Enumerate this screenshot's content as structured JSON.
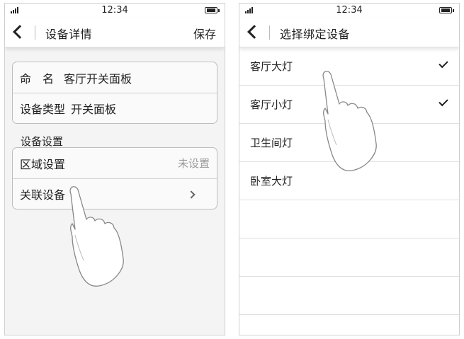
{
  "left_screen": {
    "status": {
      "time": "12:34"
    },
    "header": {
      "title": "设备详情",
      "action": "保存"
    },
    "info_card": {
      "rows": [
        {
          "label": "命　名",
          "value": "客厅开关面板"
        },
        {
          "label": "设备类型",
          "value": "开关面板"
        }
      ]
    },
    "settings_section": {
      "title": "设备设置",
      "rows": [
        {
          "label": "区域设置",
          "aside": "未设置"
        },
        {
          "label": "关联设备"
        }
      ]
    }
  },
  "right_screen": {
    "status": {
      "time": "12:34"
    },
    "header": {
      "title": "选择绑定设备"
    },
    "devices": [
      {
        "label": "客厅大灯",
        "checked": true
      },
      {
        "label": "客厅小灯",
        "checked": true
      },
      {
        "label": "卫生间灯",
        "checked": false
      },
      {
        "label": "卧室大灯",
        "checked": false
      }
    ],
    "empty_row_count": 3
  },
  "icons": {
    "signal": "signal-icon",
    "battery": "battery-icon",
    "back": "back-chevron-icon",
    "forward": "chevron-right-icon",
    "check": "checkmark-icon",
    "gesture": "pointing-hand-icon"
  }
}
